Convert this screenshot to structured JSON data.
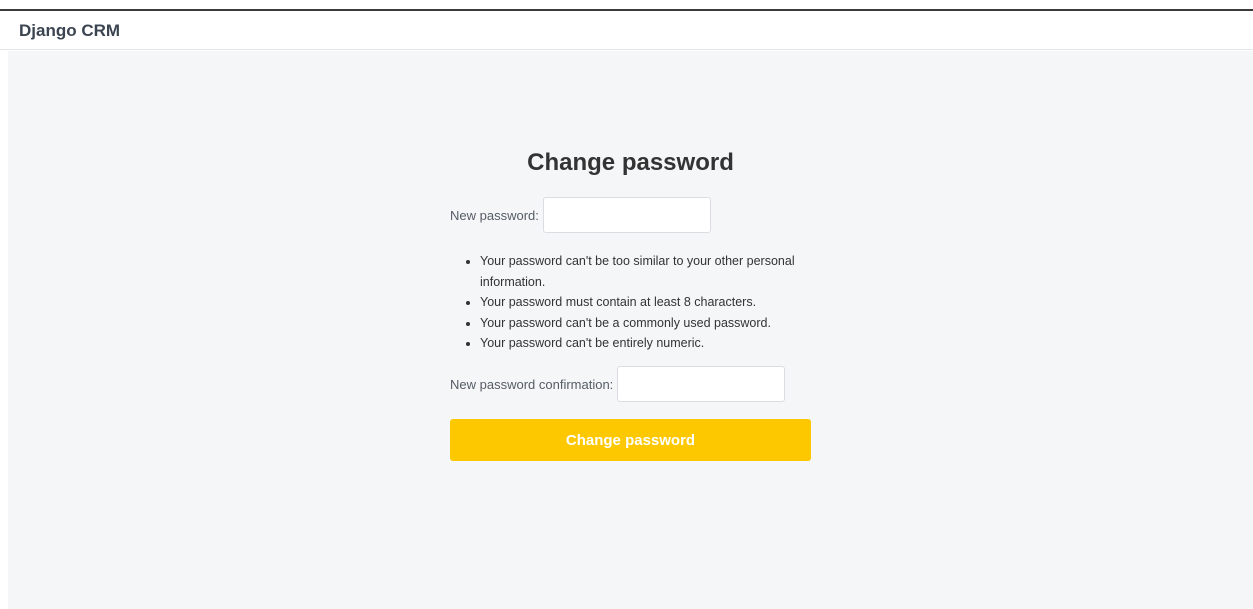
{
  "app": {
    "brand": "Django CRM"
  },
  "page": {
    "title": "Change password"
  },
  "form": {
    "new_password_label": "New password:",
    "new_password_value": "",
    "help_items": [
      "Your password can't be too similar to your other personal information.",
      "Your password must contain at least 8 characters.",
      "Your password can't be a commonly used password.",
      "Your password can't be entirely numeric."
    ],
    "confirm_label": "New password confirmation:",
    "confirm_value": "",
    "submit_label": "Change password"
  },
  "colors": {
    "accent": "#fdc800",
    "background": "#f5f6f8",
    "header_text": "#3b4451"
  }
}
